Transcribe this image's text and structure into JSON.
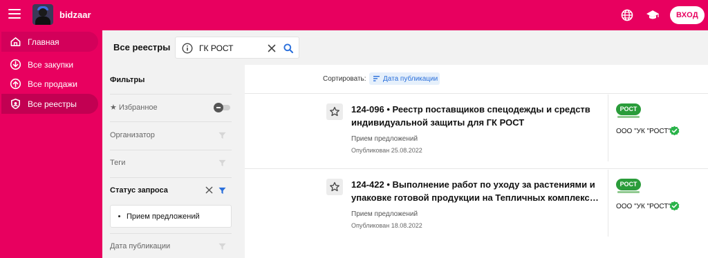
{
  "header": {
    "brand": "bidzaar",
    "login_label": "ВХОД"
  },
  "sidebar": {
    "items": [
      {
        "label": "Главная",
        "icon": "home-icon"
      },
      {
        "label": "Все закупки",
        "icon": "download-circle-icon"
      },
      {
        "label": "Все продажи",
        "icon": "upload-circle-icon"
      },
      {
        "label": "Все реестры",
        "icon": "shield-icon",
        "active": true
      }
    ]
  },
  "main": {
    "title": "Все реестры",
    "search": {
      "value": "ГК РОСТ"
    }
  },
  "filters": {
    "title": "Фильтры",
    "favorites_label": "★ Избранное",
    "organizer_label": "Организатор",
    "tags_label": "Теги",
    "status_label": "Статус запроса",
    "status_value": "Прием предложений",
    "pubdate_label": "Дата публикации"
  },
  "sort": {
    "label": "Сортировать:",
    "value": "Дата публикации"
  },
  "results": [
    {
      "title_line1": "124-096 • Реестр поставщиков спецодежды и средств",
      "title_line2": "индивидуальной защиты для ГК РОСТ",
      "stage": "Прием предложений",
      "published": "Опубликован 25.08.2022",
      "org_logo_text": "РОСТ",
      "org_name": "ООО \"УК \"РОСТ\""
    },
    {
      "title_line1": "124-422 • Выполнение работ по уходу за растениями и",
      "title_line2": "упаковке готовой продукции на Тепличных комплексах,...",
      "stage": "Прием предложений",
      "published": "Опубликован 18.08.2022",
      "org_logo_text": "РОСТ",
      "org_name": "ООО \"УК \"РОСТ\""
    }
  ],
  "colors": {
    "brand": "#e8005f",
    "sidebar_active": "#c20052",
    "link_blue": "#2a6fdb",
    "verified_green": "#2ab34a",
    "org_green": "#2a9c3a"
  }
}
